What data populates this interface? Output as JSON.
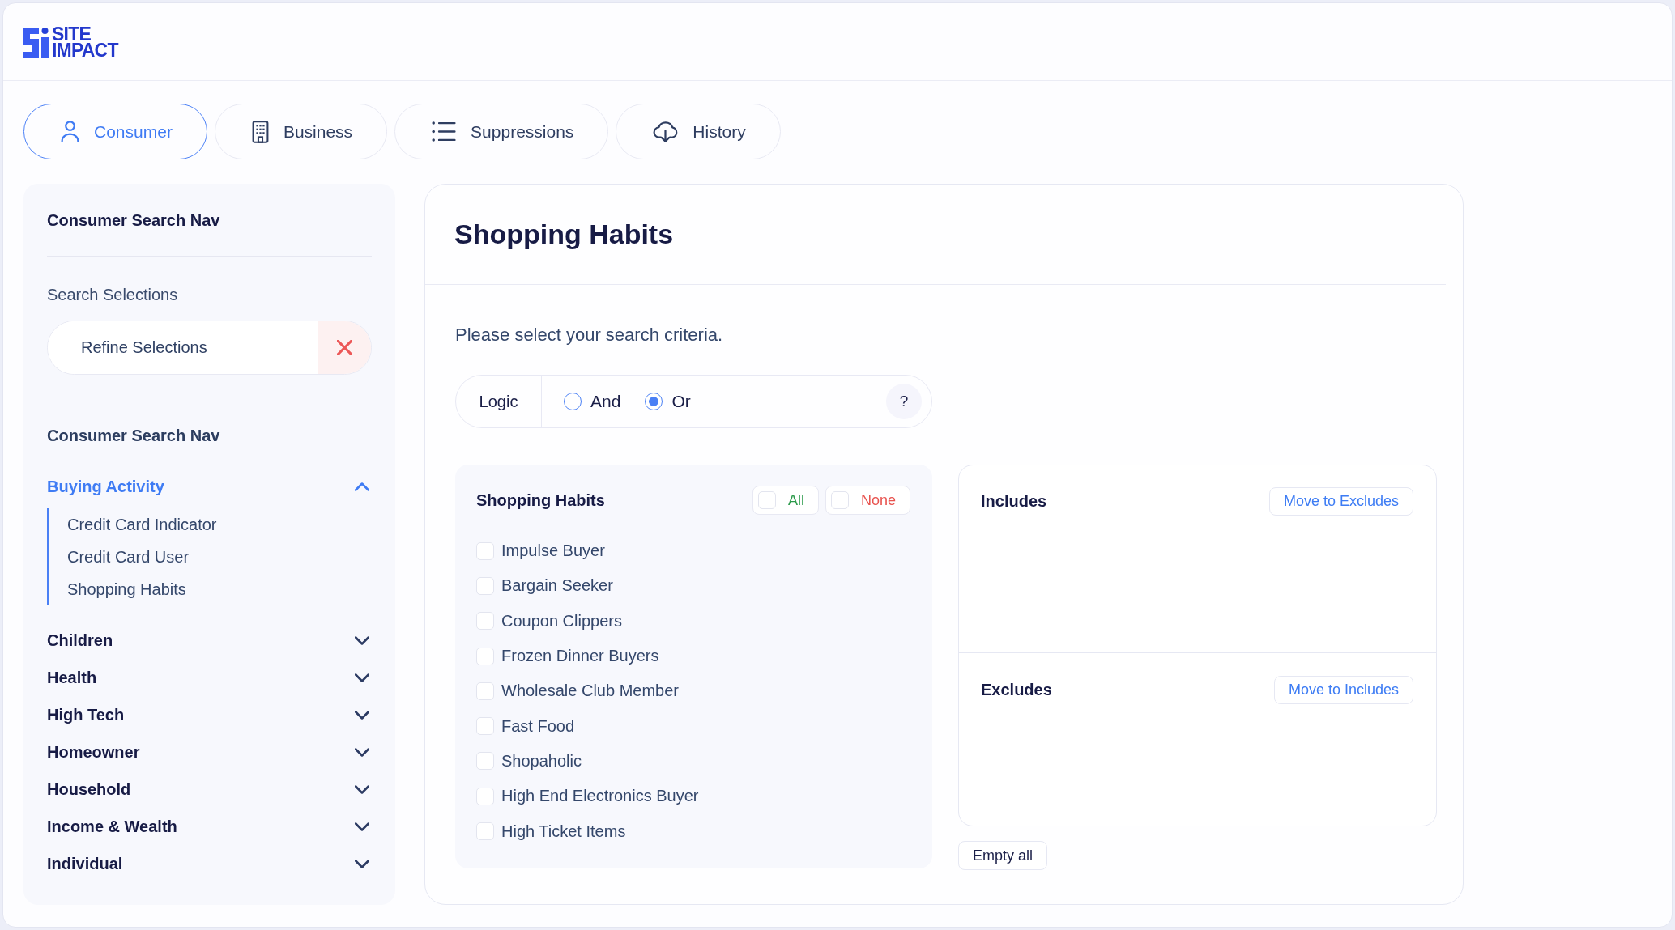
{
  "logo": {
    "lines": [
      "SITE",
      "IMPACT"
    ]
  },
  "tabs": [
    {
      "label": "Consumer",
      "kind": "consumer",
      "selected": true
    },
    {
      "label": "Business",
      "kind": "business",
      "selected": false
    },
    {
      "label": "Suppressions",
      "kind": "suppressions",
      "selected": false
    },
    {
      "label": "History",
      "kind": "history",
      "selected": false
    }
  ],
  "sidebar": {
    "title": "Consumer Search Nav",
    "selections_label": "Search Selections",
    "refine_button": "Refine Selections",
    "nav_title": "Consumer Search Nav",
    "categories": [
      {
        "label": "Buying Activity",
        "expanded": true,
        "children": [
          {
            "label": "Credit Card Indicator"
          },
          {
            "label": "Credit Card User"
          },
          {
            "label": "Shopping Habits"
          }
        ]
      },
      {
        "label": "Children",
        "expanded": false
      },
      {
        "label": "Health",
        "expanded": false
      },
      {
        "label": "High Tech",
        "expanded": false
      },
      {
        "label": "Homeowner",
        "expanded": false
      },
      {
        "label": "Household",
        "expanded": false
      },
      {
        "label": "Income & Wealth",
        "expanded": false
      },
      {
        "label": "Individual",
        "expanded": false
      }
    ]
  },
  "main": {
    "title": "Shopping Habits",
    "instruction": "Please select your search criteria.",
    "logic": {
      "label": "Logic",
      "options": [
        {
          "label": "And",
          "selected": false
        },
        {
          "label": "Or",
          "selected": true
        }
      ],
      "help_button": "?"
    },
    "criteria": {
      "title": "Shopping Habits",
      "select_all": {
        "label": "All",
        "checked": false
      },
      "select_none": {
        "label": "None",
        "checked": false
      },
      "items": [
        {
          "label": "Impulse Buyer",
          "checked": false
        },
        {
          "label": "Bargain Seeker",
          "checked": false
        },
        {
          "label": "Coupon Clippers",
          "checked": false
        },
        {
          "label": "Frozen Dinner Buyers",
          "checked": false
        },
        {
          "label": "Wholesale Club Member",
          "checked": false
        },
        {
          "label": "Fast Food",
          "checked": false
        },
        {
          "label": "Shopaholic",
          "checked": false
        },
        {
          "label": "High End Electronics Buyer",
          "checked": false
        },
        {
          "label": "High Ticket Items",
          "checked": false
        }
      ]
    },
    "selection": {
      "sections": [
        {
          "title": "Includes",
          "button": "Move to Excludes"
        },
        {
          "title": "Excludes",
          "button": "Move to Includes"
        }
      ],
      "empty_button": "Empty all"
    }
  }
}
